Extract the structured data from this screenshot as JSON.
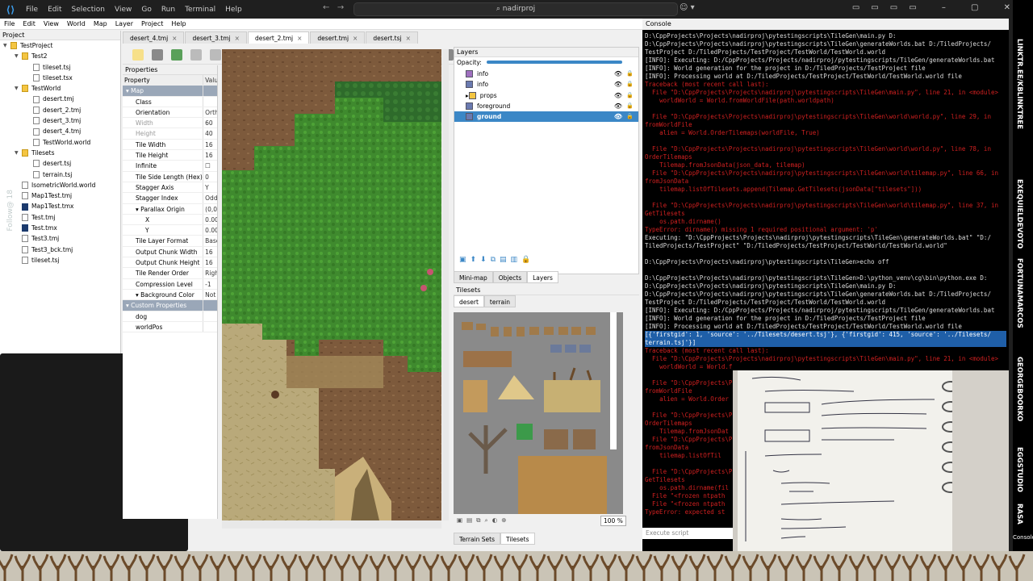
{
  "vscode": {
    "menu": [
      "File",
      "Edit",
      "Selection",
      "View",
      "Go",
      "Run",
      "Terminal",
      "Help"
    ],
    "search": "nadirproj"
  },
  "tiled": {
    "menu": [
      "File",
      "Edit",
      "View",
      "World",
      "Map",
      "Layer",
      "Project",
      "Help"
    ],
    "project_title": "Project",
    "project_tree": [
      {
        "label": "TestProject",
        "kind": "folder",
        "indent": 0,
        "open": true
      },
      {
        "label": "Test2",
        "kind": "folder",
        "indent": 1,
        "open": true
      },
      {
        "label": "tileset.tsj",
        "kind": "file",
        "indent": 2
      },
      {
        "label": "tileset.tsx",
        "kind": "file",
        "indent": 2
      },
      {
        "label": "TestWorld",
        "kind": "folder",
        "indent": 1,
        "open": true
      },
      {
        "label": "desert.tmj",
        "kind": "file",
        "indent": 2
      },
      {
        "label": "desert_2.tmj",
        "kind": "file",
        "indent": 2
      },
      {
        "label": "desert_3.tmj",
        "kind": "file",
        "indent": 2
      },
      {
        "label": "desert_4.tmj",
        "kind": "file",
        "indent": 2
      },
      {
        "label": "TestWorld.world",
        "kind": "file",
        "indent": 2
      },
      {
        "label": "Tilesets",
        "kind": "folder",
        "indent": 1,
        "open": true
      },
      {
        "label": "desert.tsj",
        "kind": "file",
        "indent": 2
      },
      {
        "label": "terrain.tsj",
        "kind": "file",
        "indent": 2
      },
      {
        "label": "IsometricWorld.world",
        "kind": "file",
        "indent": 1
      },
      {
        "label": "Map1Test.tmj",
        "kind": "file",
        "indent": 1
      },
      {
        "label": "Map1Test.tmx",
        "kind": "tmx",
        "indent": 1
      },
      {
        "label": "Test.tmj",
        "kind": "file",
        "indent": 1
      },
      {
        "label": "Test.tmx",
        "kind": "tmx",
        "indent": 1
      },
      {
        "label": "Test3.tmj",
        "kind": "file",
        "indent": 1
      },
      {
        "label": "Test3_bck.tmj",
        "kind": "file",
        "indent": 1
      },
      {
        "label": "tileset.tsj",
        "kind": "file",
        "indent": 1
      }
    ],
    "follow_text": "Follow@ 18",
    "doc_tabs": [
      {
        "label": "desert_4.tmj",
        "active": false
      },
      {
        "label": "desert_3.tmj",
        "active": false
      },
      {
        "label": "desert_2.tmj",
        "active": true
      },
      {
        "label": "desert.tmj",
        "active": false
      },
      {
        "label": "desert.tsj",
        "active": false
      }
    ],
    "properties_title": "Properties",
    "properties_header": {
      "name": "Property",
      "value": "Valu"
    },
    "properties": [
      {
        "name": "Map",
        "value": "",
        "type": "group"
      },
      {
        "name": "Class",
        "value": "",
        "type": "normal"
      },
      {
        "name": "Orientation",
        "value": "Orth",
        "type": "normal"
      },
      {
        "name": "Width",
        "value": "60",
        "type": "dim"
      },
      {
        "name": "Height",
        "value": "40",
        "type": "dim"
      },
      {
        "name": "Tile Width",
        "value": "16",
        "type": "normal"
      },
      {
        "name": "Tile Height",
        "value": "16",
        "type": "normal"
      },
      {
        "name": "Infinite",
        "value": "☐",
        "type": "normal"
      },
      {
        "name": "Tile Side Length (Hex)",
        "value": "0",
        "type": "normal"
      },
      {
        "name": "Stagger Axis",
        "value": "Y",
        "type": "normal"
      },
      {
        "name": "Stagger Index",
        "value": "Odd",
        "type": "normal"
      },
      {
        "name": "Parallax Origin",
        "value": "(0,0",
        "type": "expand"
      },
      {
        "name": "X",
        "value": "0.00",
        "type": "sub"
      },
      {
        "name": "Y",
        "value": "0.00",
        "type": "sub"
      },
      {
        "name": "Tile Layer Format",
        "value": "Base",
        "type": "normal"
      },
      {
        "name": "Output Chunk Width",
        "value": "16",
        "type": "normal"
      },
      {
        "name": "Output Chunk Height",
        "value": "16",
        "type": "normal"
      },
      {
        "name": "Tile Render Order",
        "value": "Righ",
        "type": "normal"
      },
      {
        "name": "Compression Level",
        "value": "-1",
        "type": "normal"
      },
      {
        "name": "Background Color",
        "value": "Not",
        "type": "expand"
      },
      {
        "name": "Custom Properties",
        "value": "",
        "type": "group"
      },
      {
        "name": "dog",
        "value": "",
        "type": "normal"
      },
      {
        "name": "worldPos",
        "value": "",
        "type": "normal"
      }
    ],
    "layers_title": "Layers",
    "opacity_label": "Opacity:",
    "layers": [
      {
        "label": "info",
        "kind": "object",
        "selected": false
      },
      {
        "label": "info",
        "kind": "tile",
        "selected": false
      },
      {
        "label": "props",
        "kind": "group",
        "selected": false
      },
      {
        "label": "foreground",
        "kind": "tile",
        "selected": false
      },
      {
        "label": "ground",
        "kind": "tile",
        "selected": true
      }
    ],
    "layer_tabs": [
      {
        "label": "Mini-map",
        "active": false
      },
      {
        "label": "Objects",
        "active": false
      },
      {
        "label": "Layers",
        "active": true
      }
    ],
    "tilesets_title": "Tilesets",
    "tileset_tabs": [
      {
        "label": "desert",
        "active": true
      },
      {
        "label": "terrain",
        "active": false
      }
    ],
    "zoom": "100 %",
    "bottom_tabs": [
      {
        "label": "Terrain Sets",
        "active": false
      },
      {
        "label": "Tilesets",
        "active": true
      }
    ]
  },
  "console": {
    "title": "Console",
    "input_placeholder": "Execute script",
    "lines": [
      {
        "t": "D:\\CppProjects\\Projects\\nadirproj\\pytestingscripts\\TileGen\\main.py D:",
        "c": ""
      },
      {
        "t": "D:\\CppProjects\\Projects\\nadirproj\\pytestingscripts\\TileGen\\generateWorlds.bat D:/TiledProjects/",
        "c": ""
      },
      {
        "t": "TestProject D:/TiledProjects/TestProject/TestWorld/TestWorld.world",
        "c": ""
      },
      {
        "t": "[INFO]: Executing: D:/CppProjects/Projects/nadirproj/pytestingscripts/TileGen/generateWorlds.bat",
        "c": ""
      },
      {
        "t": "[INFO]: World generation for the project in D:/TiledProjects/TestProject file",
        "c": ""
      },
      {
        "t": "[INFO]: Processing world at D:/TiledProjects/TestProject/TestWorld/TestWorld.world file",
        "c": ""
      },
      {
        "t": "Traceback (most recent call last):",
        "c": "err"
      },
      {
        "t": "  File \"D:\\CppProjects\\Projects\\nadirproj\\pytestingscripts\\TileGen\\main.py\", line 21, in <module>",
        "c": "err"
      },
      {
        "t": "    worldWorld = World.fromWorldFile(path.worldpath)",
        "c": "err"
      },
      {
        "t": "",
        "c": ""
      },
      {
        "t": "  File \"D:\\CppProjects\\Projects\\nadirproj\\pytestingscripts\\TileGen\\world\\world.py\", line 29, in",
        "c": "err"
      },
      {
        "t": "fromWorldFile",
        "c": "err"
      },
      {
        "t": "    alien = World.OrderTilemaps(worldFile, True)",
        "c": "err"
      },
      {
        "t": "",
        "c": ""
      },
      {
        "t": "  File \"D:\\CppProjects\\Projects\\nadirproj\\pytestingscripts\\TileGen\\world\\world.py\", line 78, in",
        "c": "err"
      },
      {
        "t": "OrderTilemaps",
        "c": "err"
      },
      {
        "t": "    Tilemap.fromJsonData(json_data, tilemap)",
        "c": "err"
      },
      {
        "t": "  File \"D:\\CppProjects\\Projects\\nadirproj\\pytestingscripts\\TileGen\\world\\tilemap.py\", line 66, in",
        "c": "err"
      },
      {
        "t": "fromJsonData",
        "c": "err"
      },
      {
        "t": "    tilemap.listOfTilesets.append(Tilemap.GetTilesets(jsonData[\"tilesets\"]))",
        "c": "err"
      },
      {
        "t": "",
        "c": ""
      },
      {
        "t": "  File \"D:\\CppProjects\\Projects\\nadirproj\\pytestingscripts\\TileGen\\world\\tilemap.py\", line 37, in",
        "c": "err"
      },
      {
        "t": "GetTilesets",
        "c": "err"
      },
      {
        "t": "    os.path.dirname()",
        "c": "err"
      },
      {
        "t": "TypeError: dirname() missing 1 required positional argument: 'p'",
        "c": "err"
      },
      {
        "t": "Executing: \"D:\\CppProjects\\Projects\\nadirproj\\pytestingscripts\\TileGen\\generateWorlds.bat\" \"D:/",
        "c": ""
      },
      {
        "t": "TiledProjects/TestProject\" \"D:/TiledProjects/TestProject/TestWorld/TestWorld.world\"",
        "c": ""
      },
      {
        "t": "",
        "c": ""
      },
      {
        "t": "D:\\CppProjects\\Projects\\nadirproj\\pytestingscripts\\TileGen>echo off",
        "c": ""
      },
      {
        "t": "",
        "c": ""
      },
      {
        "t": "D:\\CppProjects\\Projects\\nadirproj\\pytestingscripts\\TileGen>D:\\python_venv\\cg\\bin\\python.exe D:",
        "c": ""
      },
      {
        "t": "D:\\CppProjects\\Projects\\nadirproj\\pytestingscripts\\TileGen\\main.py D:",
        "c": ""
      },
      {
        "t": "D:\\CppProjects\\Projects\\nadirproj\\pytestingscripts\\TileGen\\generateWorlds.bat D:/TiledProjects/",
        "c": ""
      },
      {
        "t": "TestProject D:/TiledProjects/TestProject/TestWorld/TestWorld.world",
        "c": ""
      },
      {
        "t": "[INFO]: Executing: D:/CppProjects/Projects/nadirproj/pytestingscripts/TileGen/generateWorlds.bat",
        "c": ""
      },
      {
        "t": "[INFO]: World generation for the project in D:/TiledProjects/TestProject file",
        "c": ""
      },
      {
        "t": "[INFO]: Processing world at D:/TiledProjects/TestProject/TestWorld/TestWorld.world file",
        "c": ""
      },
      {
        "t": "[{'firstgid': 1, 'source': '../Tilesets/desert.tsj'}, {'firstgid': 415, 'source': '../Tilesets/",
        "c": "hl"
      },
      {
        "t": "terrain.tsj'}]",
        "c": "hl"
      },
      {
        "t": "Traceback (most recent call last):",
        "c": "err"
      },
      {
        "t": "  File \"D:\\CppProjects\\Projects\\nadirproj\\pytestingscripts\\TileGen\\main.py\", line 21, in <module>",
        "c": "err"
      },
      {
        "t": "    worldWorld = World.f",
        "c": "err"
      },
      {
        "t": "",
        "c": ""
      },
      {
        "t": "  File \"D:\\CppProjects\\P",
        "c": "err"
      },
      {
        "t": "fromWorldFile",
        "c": "err"
      },
      {
        "t": "    alien = World.Order",
        "c": "err"
      },
      {
        "t": "",
        "c": ""
      },
      {
        "t": "  File \"D:\\CppProjects\\P",
        "c": "err"
      },
      {
        "t": "OrderTilemaps",
        "c": "err"
      },
      {
        "t": "    Tilemap.fromJsonDat",
        "c": "err"
      },
      {
        "t": "  File \"D:\\CppProjects\\P",
        "c": "err"
      },
      {
        "t": "fromJsonData",
        "c": "err"
      },
      {
        "t": "    tilemap.listOfTil",
        "c": "err"
      },
      {
        "t": "",
        "c": ""
      },
      {
        "t": "  File \"D:\\CppProjects\\P",
        "c": "err"
      },
      {
        "t": "GetTilesets",
        "c": "err"
      },
      {
        "t": "    os.path.dirname(fil",
        "c": "err"
      },
      {
        "t": "  File \"<frozen ntpath",
        "c": "err"
      },
      {
        "t": "  File \"<frozen ntpath",
        "c": "err"
      },
      {
        "t": "TypeError: expected st",
        "c": "err"
      }
    ]
  },
  "side_banner": [
    "LINKTR.EE/KBLINKTREE",
    "EXEQUIELDEVOTO",
    "FORTUNAMARCOS",
    "GEORGEBOORKO",
    "EGGSTUDIO",
    "RASA"
  ],
  "side_banner_bottom": "Console",
  "colors": {
    "selection": "#3b87c6",
    "error": "#d02020",
    "highlight": "#1f5fa8",
    "group_row": "#9aa7b8"
  }
}
